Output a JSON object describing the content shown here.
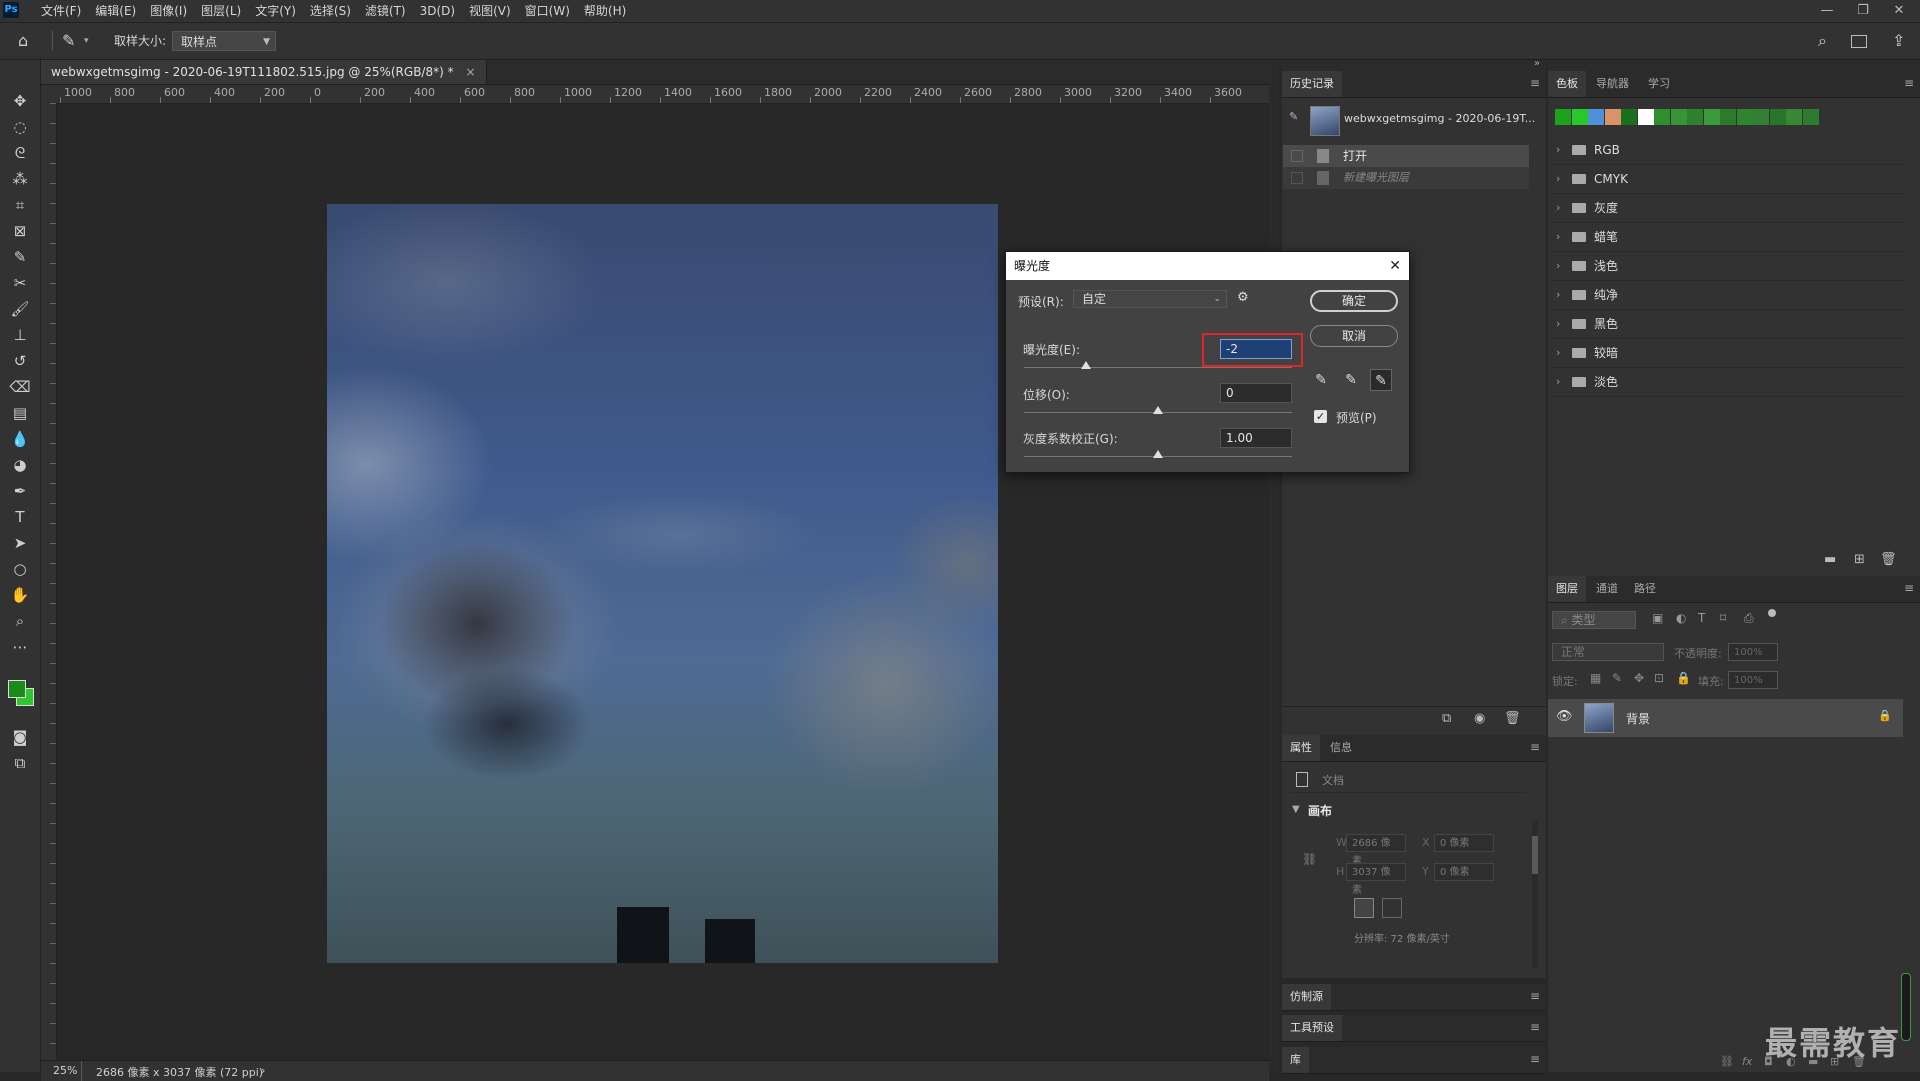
{
  "menubar": {
    "logo": "Ps",
    "items": [
      "文件(F)",
      "编辑(E)",
      "图像(I)",
      "图层(L)",
      "文字(Y)",
      "选择(S)",
      "滤镜(T)",
      "3D(D)",
      "视图(V)",
      "窗口(W)",
      "帮助(H)"
    ],
    "minimize": "—",
    "restore": "❐",
    "close": "✕"
  },
  "options": {
    "sample_size_label": "取样大小:",
    "sample_size_value": "取样点"
  },
  "document": {
    "tab_title": "webwxgetmsgimg - 2020-06-19T111802.515.jpg @ 25%(RGB/8*) *",
    "tab_close": "×",
    "ruler_labels": [
      "1000",
      "800",
      "600",
      "400",
      "200",
      "0",
      "200",
      "400",
      "600",
      "800",
      "1000",
      "1200",
      "1400",
      "1600",
      "1800",
      "2000",
      "2200",
      "2400",
      "2600",
      "2800",
      "3000",
      "3200",
      "3400",
      "3600"
    ]
  },
  "status": {
    "zoom": "25%",
    "info": "2686 像素 x 3037 像素 (72 ppi)",
    "arrow": "›"
  },
  "history": {
    "tab": "历史记录",
    "snapshot": "webwxgetmsgimg - 2020-06-19T...",
    "items": [
      "打开",
      "新建曝光图层"
    ]
  },
  "swatches": {
    "tabs": [
      "色板",
      "导航器",
      "学习"
    ],
    "recent_colors": [
      "#1ea21e",
      "#28c828",
      "#4f91d6",
      "#d9926a",
      "#1b6e1b",
      "#ffffff",
      "#2f8f2f",
      "#379437",
      "#2e802e",
      "#3a9b3a",
      "#2c7a2c",
      "#2f852f",
      "#347f34",
      "#2b742b",
      "#378737",
      "#2d7c2d"
    ],
    "folders": [
      "RGB",
      "CMYK",
      "灰度",
      "蜡笔",
      "浅色",
      "纯净",
      "黑色",
      "较暗",
      "淡色"
    ]
  },
  "properties": {
    "tabs": [
      "属性",
      "信息"
    ],
    "doc_label": "文档",
    "canvas_label": "画布",
    "w_label": "W",
    "w_value": "2686 像素",
    "h_label": "H",
    "h_value": "3037 像素",
    "x_label": "X",
    "x_value": "0 像素",
    "y_label": "Y",
    "y_value": "0 像素",
    "resolution": "分辨率: 72 像素/英寸"
  },
  "clone_source": {
    "tab": "仿制源"
  },
  "tool_presets": {
    "tab": "工具预设"
  },
  "library": {
    "tab": "库"
  },
  "layers": {
    "tabs": [
      "图层",
      "通道",
      "路径"
    ],
    "filter_placeholder": "类型",
    "blend_mode": "正常",
    "opacity_label": "不透明度:",
    "opacity_value": "100%",
    "lock_label": "锁定:",
    "fill_label": "填充:",
    "fill_value": "100%",
    "layer_name": "背景"
  },
  "dialog": {
    "title": "曝光度",
    "preset_label": "预设(R):",
    "preset_value": "自定",
    "exposure_label": "曝光度(E):",
    "exposure_value": "-2",
    "exposure_fraction": 0.23,
    "offset_label": "位移(O):",
    "offset_value": "0",
    "offset_fraction": 0.5,
    "gamma_label": "灰度系数校正(G):",
    "gamma_value": "1.00",
    "gamma_fraction": 0.5,
    "ok": "确定",
    "cancel": "取消",
    "preview_label": "预览(P)",
    "preview_checked": true
  },
  "watermark": "最需教育"
}
